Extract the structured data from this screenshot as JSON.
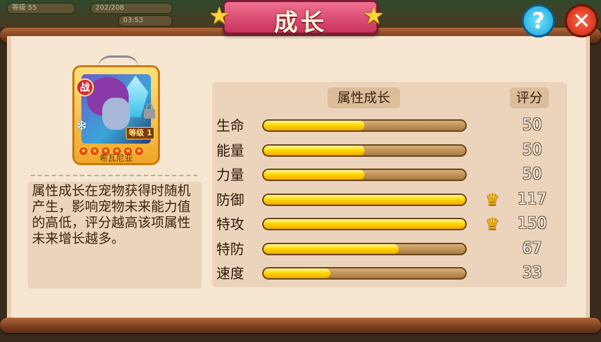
{
  "hud": {
    "level": "等级 55",
    "stamina": "202/208",
    "timer": "03:53"
  },
  "title": "成长",
  "help_label": "?",
  "close_label": "✕",
  "pet": {
    "name": "希瓦尼亚",
    "type_badge": "战",
    "level_label": "等级 1",
    "stars": 6
  },
  "description": "属性成长在宠物获得时随机产生，影响宠物未来能力值的高低，评分越高该项属性未来增长越多。",
  "stats": {
    "growth_header": "属性成长",
    "score_header": "评分",
    "rows": [
      {
        "label": "生命",
        "fill": 0.5,
        "score": "50",
        "crown": false
      },
      {
        "label": "能量",
        "fill": 0.5,
        "score": "50",
        "crown": false
      },
      {
        "label": "力量",
        "fill": 0.5,
        "score": "50",
        "crown": false
      },
      {
        "label": "防御",
        "fill": 1.0,
        "score": "117",
        "crown": true
      },
      {
        "label": "特攻",
        "fill": 1.0,
        "score": "150",
        "crown": true
      },
      {
        "label": "特防",
        "fill": 0.67,
        "score": "67",
        "crown": false
      },
      {
        "label": "速度",
        "fill": 0.33,
        "score": "33",
        "crown": false
      }
    ]
  },
  "colors": {
    "banner": "#e04a72",
    "bar_fill": "#ffd800",
    "panel": "#f6e6d2"
  },
  "icons": {
    "crown": "crown-icon",
    "help": "question-icon",
    "close": "close-icon",
    "star": "star-icon",
    "lock": "lock-icon"
  }
}
